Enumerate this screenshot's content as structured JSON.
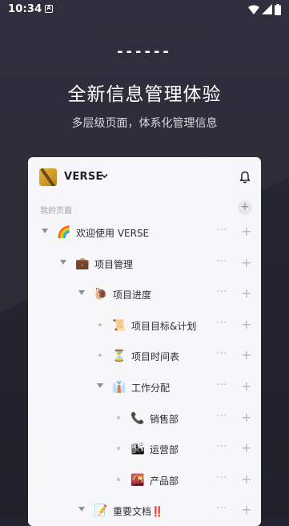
{
  "status_bar": {
    "time": "10:34",
    "notification_glyph": "A"
  },
  "promo": {
    "decoration": "------",
    "headline": "全新信息管理体验",
    "subheadline": "多层级页面，体系化管理信息"
  },
  "workspace": {
    "name": "VERSE",
    "section_label": "我的页面",
    "section_add": "+",
    "row_more": "···",
    "row_add": "+"
  },
  "tree": [
    {
      "label": "欢迎使用 VERSE",
      "icon": "rainbow-icon",
      "emoji": "🌈",
      "kind": "expanded",
      "level": 0
    },
    {
      "label": "项目管理",
      "icon": "briefcase-icon",
      "emoji": "💼",
      "kind": "expanded",
      "level": 1
    },
    {
      "label": "项目进度",
      "icon": "snail-icon",
      "emoji": "🐌",
      "kind": "expanded",
      "level": 2
    },
    {
      "label": "项目目标&计划",
      "icon": "scroll-icon",
      "emoji": "📜",
      "kind": "leaf",
      "level": 3
    },
    {
      "label": "项目时间表",
      "icon": "hourglass-icon",
      "emoji": "⏳",
      "kind": "leaf",
      "level": 3
    },
    {
      "label": "工作分配",
      "icon": "person-icon",
      "emoji": "👔",
      "kind": "expanded",
      "level": 3
    },
    {
      "label": "销售部",
      "icon": "telephone-icon",
      "emoji": "📞",
      "kind": "leaf",
      "level": 4
    },
    {
      "label": "运营部",
      "icon": "cityscape-icon",
      "emoji": "🏙",
      "kind": "leaf",
      "level": 4
    },
    {
      "label": "产品部",
      "icon": "sunset-icon",
      "emoji": "🌇",
      "kind": "leaf",
      "level": 4
    },
    {
      "label": "重要文档‼️",
      "icon": "memo-icon",
      "emoji": "📝",
      "kind": "expanded",
      "level": 2
    }
  ]
}
